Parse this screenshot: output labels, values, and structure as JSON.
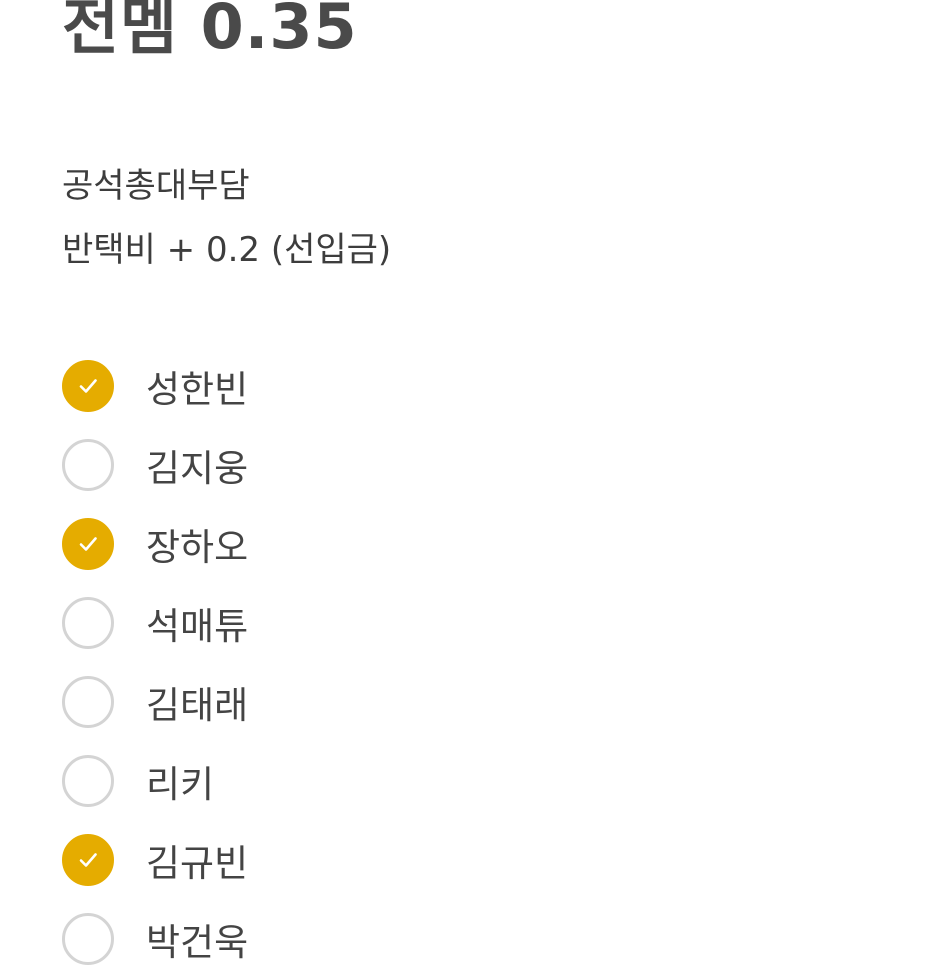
{
  "title": "전멤 0.35",
  "description": {
    "line1": "공석총대부담",
    "line2": "반택비 + 0.2 (선입금)"
  },
  "accent_color": "#e5ac00",
  "unchecked_border_color": "#d4d4d4",
  "members": [
    {
      "name": "성한빈",
      "checked": true
    },
    {
      "name": "김지웅",
      "checked": false
    },
    {
      "name": "장하오",
      "checked": true
    },
    {
      "name": "석매튜",
      "checked": false
    },
    {
      "name": "김태래",
      "checked": false
    },
    {
      "name": "리키",
      "checked": false
    },
    {
      "name": "김규빈",
      "checked": true
    },
    {
      "name": "박건욱",
      "checked": false
    }
  ]
}
